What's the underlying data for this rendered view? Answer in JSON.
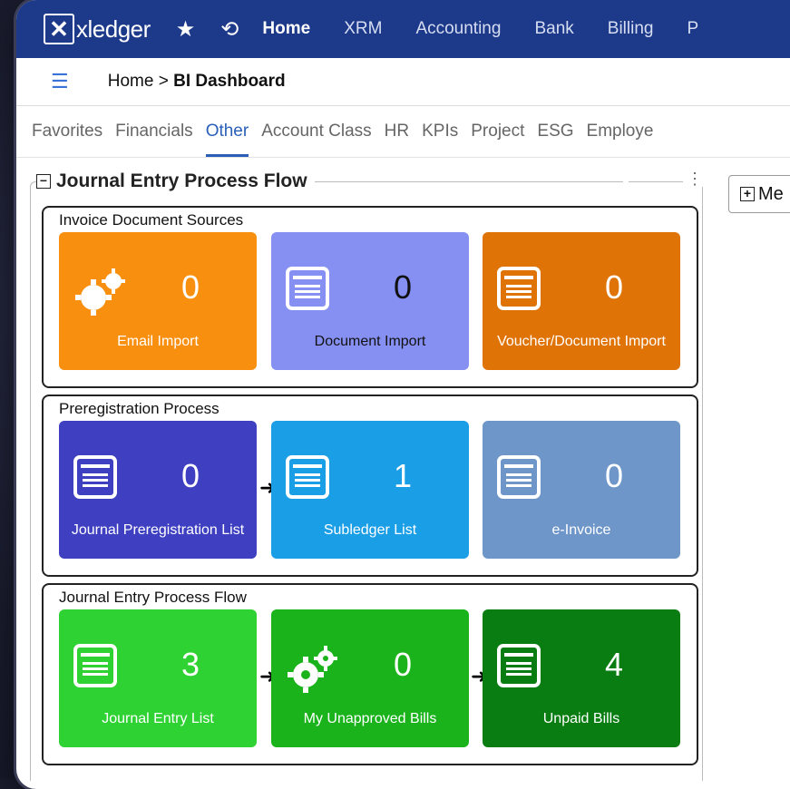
{
  "app": {
    "logo_text": "xledger"
  },
  "nav": [
    "Home",
    "XRM",
    "Accounting",
    "Bank",
    "Billing",
    "P"
  ],
  "breadcrumb": {
    "home": "Home",
    "separator": ">",
    "current": "BI Dashboard"
  },
  "tabs": [
    "Favorites",
    "Financials",
    "Other",
    "Account Class",
    "HR",
    "KPIs",
    "Project",
    "ESG",
    "Employe"
  ],
  "active_tab": "Other",
  "widget": {
    "title": "Journal Entry Process Flow",
    "menu_button": "Me"
  },
  "sections": [
    {
      "title": "Invoice Document Sources",
      "tiles": [
        {
          "label": "Email Import",
          "value": "0",
          "color": "#f98f0f",
          "icon": "gears-icon"
        },
        {
          "label": "Document Import",
          "value": "0",
          "color": "#8690f2",
          "icon": "document-list-icon"
        },
        {
          "label": "Voucher/Document Import",
          "value": "0",
          "color": "#e07306",
          "icon": "document-list-icon"
        }
      ]
    },
    {
      "title": "Preregistration Process",
      "tiles": [
        {
          "label": "Journal Preregistration List",
          "value": "0",
          "color": "#3f3fc1",
          "icon": "document-list-icon"
        },
        {
          "label": "Subledger List",
          "value": "1",
          "color": "#1a9ee6",
          "icon": "document-list-icon"
        },
        {
          "label": "e-Invoice",
          "value": "0",
          "color": "#6e96c9",
          "icon": "document-list-icon"
        }
      ]
    },
    {
      "title": "Journal Entry Process Flow",
      "tiles": [
        {
          "label": "Journal Entry List",
          "value": "3",
          "color": "#2fd233",
          "icon": "document-list-icon"
        },
        {
          "label": "My Unapproved Bills",
          "value": "0",
          "color": "#1bb31c",
          "icon": "gears-icon"
        },
        {
          "label": "Unpaid Bills",
          "value": "4",
          "color": "#0a7d12",
          "icon": "document-list-icon"
        }
      ]
    }
  ]
}
